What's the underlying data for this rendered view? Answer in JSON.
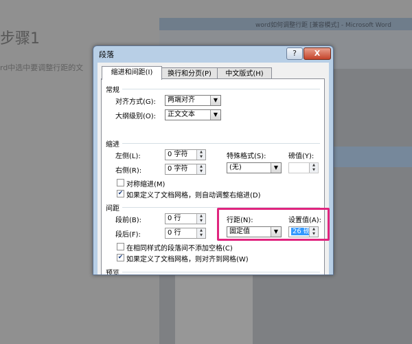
{
  "background": {
    "heading": "步骤1",
    "subtext": "rd中选中要调整行距的文",
    "word_title": "word如何调整行距 [兼容模式] - Microsoft Word"
  },
  "dialog": {
    "title": "段落",
    "help_label": "?",
    "close_label": "X",
    "tabs": [
      {
        "label": "缩进和间距(I)",
        "active": true
      },
      {
        "label": "换行和分页(P)",
        "active": false
      },
      {
        "label": "中文版式(H)",
        "active": false
      }
    ],
    "general": {
      "section_label": "常规",
      "alignment_label": "对齐方式(G):",
      "alignment_value": "两端对齐",
      "outline_label": "大纲级别(O):",
      "outline_value": "正文文本"
    },
    "indent": {
      "section_label": "缩进",
      "left_label": "左侧(L):",
      "left_value": "0 字符",
      "right_label": "右侧(R):",
      "right_value": "0 字符",
      "special_label": "特殊格式(S):",
      "special_value": "(无)",
      "by_label": "磅值(Y):",
      "by_value": "",
      "mirror_label": "对称缩进(M)",
      "mirror_checked": false,
      "auto_adjust_label": "如果定义了文档网格，则自动调整右缩进(D)",
      "auto_adjust_checked": true
    },
    "spacing": {
      "section_label": "间距",
      "before_label": "段前(B):",
      "before_value": "0 行",
      "after_label": "段后(F):",
      "after_value": "0 行",
      "line_spacing_label": "行距(N):",
      "line_spacing_value": "固定值",
      "at_label": "设置值(A):",
      "at_value": "26 磅",
      "no_space_label": "在相同样式的段落间不添加空格(C)",
      "no_space_checked": false,
      "snap_grid_label": "如果定义了文档网格，则对齐到网格(W)",
      "snap_grid_checked": true
    },
    "preview": {
      "section_label": "预览"
    }
  },
  "colors": {
    "highlight": "#e0247e",
    "selection": "#3399ff",
    "frame": "#b8cfe6"
  }
}
